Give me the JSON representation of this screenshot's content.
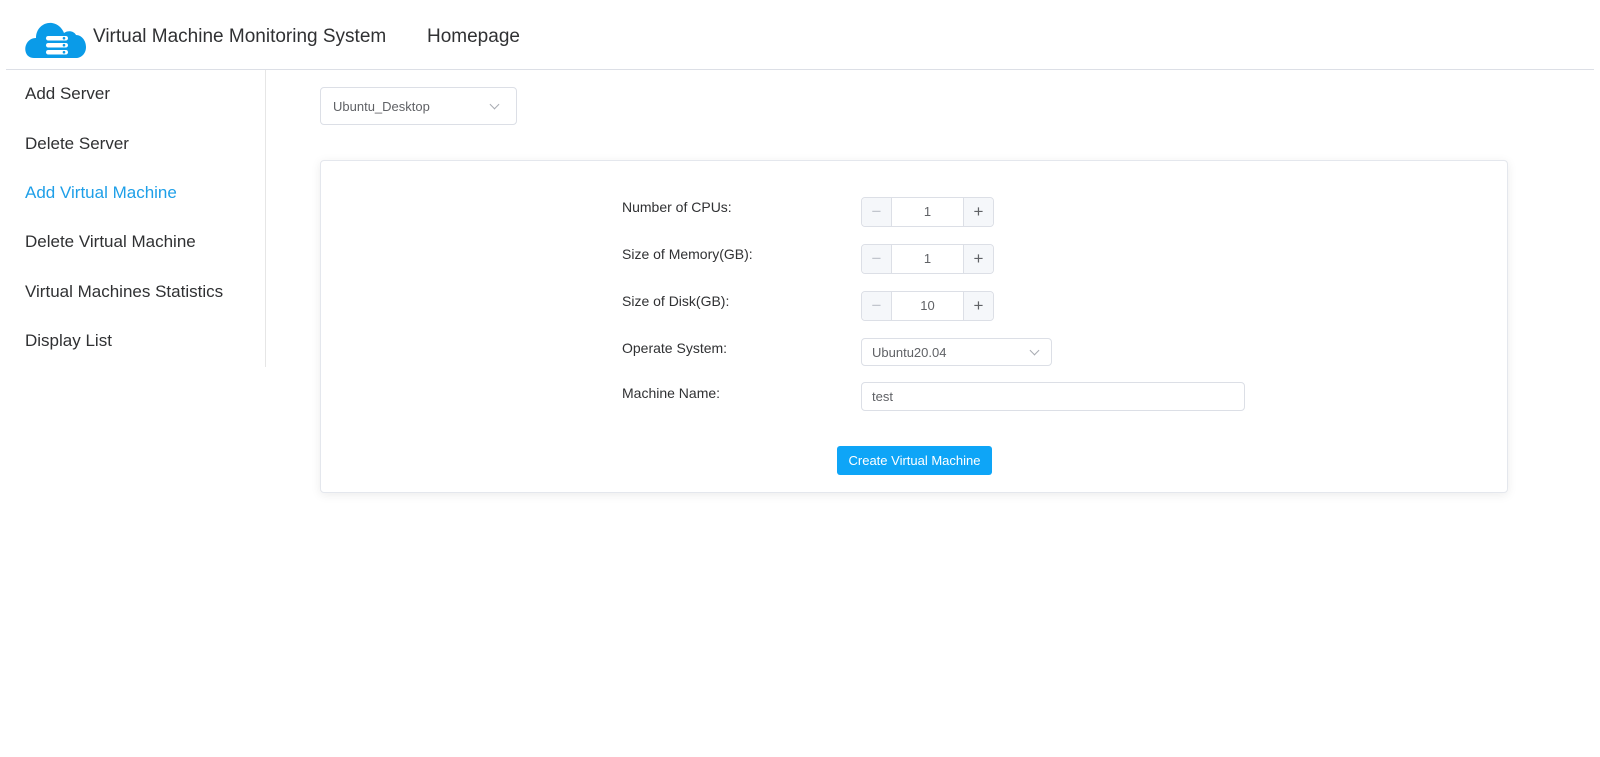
{
  "header": {
    "logo_icon": "cloud-server-icon",
    "title": "Virtual Machine Monitoring System",
    "nav_home": "Homepage"
  },
  "sidebar": {
    "items": [
      {
        "label": "Add Server",
        "active": false
      },
      {
        "label": "Delete Server",
        "active": false
      },
      {
        "label": "Add Virtual Machine",
        "active": true
      },
      {
        "label": "Delete Virtual Machine",
        "active": false
      },
      {
        "label": "Virtual Machines Statistics",
        "active": false
      },
      {
        "label": "Display List",
        "active": false
      }
    ]
  },
  "server_select": {
    "value": "Ubuntu_Desktop",
    "icon": "chevron-down-icon"
  },
  "form": {
    "cpus": {
      "label": "Number of CPUs:",
      "value": "1",
      "dec_icon": "minus-icon",
      "inc_icon": "plus-icon"
    },
    "memory": {
      "label": "Size of Memory(GB):",
      "value": "1",
      "dec_icon": "minus-icon",
      "inc_icon": "plus-icon"
    },
    "disk": {
      "label": "Size of Disk(GB):",
      "value": "10",
      "dec_icon": "minus-icon",
      "inc_icon": "plus-icon"
    },
    "os": {
      "label": "Operate System:",
      "value": "Ubuntu20.04",
      "icon": "chevron-down-icon"
    },
    "machine_name": {
      "label": "Machine Name:",
      "value": "test"
    },
    "submit_label": "Create Virtual Machine"
  },
  "colors": {
    "accent": "#1e9fe8",
    "button": "#0ea5f7",
    "logo": "#0a9be8",
    "border": "#dcdfe6"
  }
}
